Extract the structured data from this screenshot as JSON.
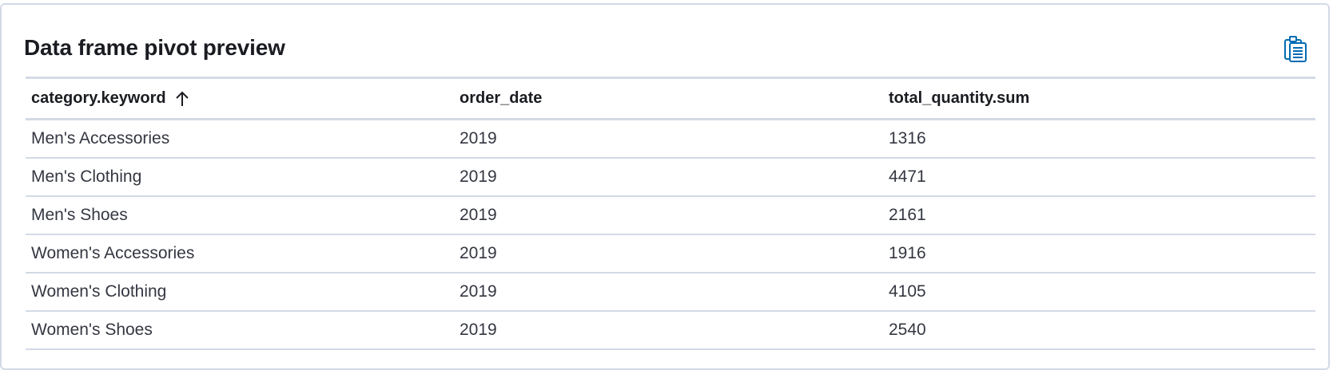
{
  "panel": {
    "title": "Data frame pivot preview",
    "copy_icon": "clipboard-icon"
  },
  "table": {
    "columns": [
      {
        "label": "category.keyword",
        "sort": "ascending",
        "sort_icon": "sort-up-arrow-icon"
      },
      {
        "label": "order_date"
      },
      {
        "label": "total_quantity.sum"
      }
    ],
    "rows": [
      [
        "Men's Accessories",
        "2019",
        "1316"
      ],
      [
        "Men's Clothing",
        "2019",
        "4471"
      ],
      [
        "Men's Shoes",
        "2019",
        "2161"
      ],
      [
        "Women's Accessories",
        "2019",
        "1916"
      ],
      [
        "Women's Clothing",
        "2019",
        "4105"
      ],
      [
        "Women's Shoes",
        "2019",
        "2540"
      ]
    ]
  },
  "colors": {
    "border": "#d3dae6",
    "text": "#343741",
    "heading": "#1a1c21",
    "icon": "#006bb4"
  }
}
